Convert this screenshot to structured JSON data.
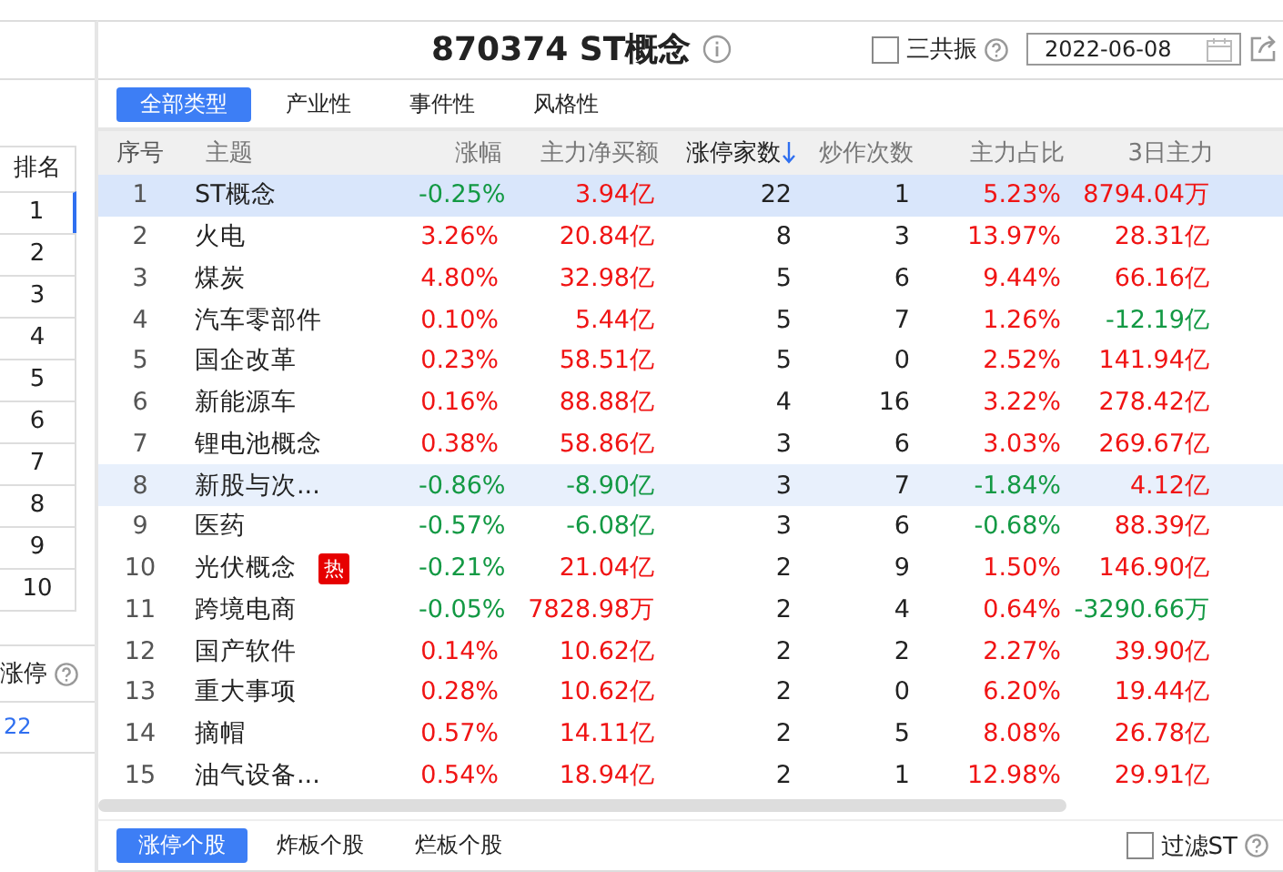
{
  "left_panel": {
    "rank_header": "排名",
    "ranks": [
      {
        "label": "1",
        "selected": true
      },
      {
        "label": "2",
        "selected": false
      },
      {
        "label": "3",
        "selected": false
      },
      {
        "label": "4",
        "selected": false
      },
      {
        "label": "5",
        "selected": false
      },
      {
        "label": "6",
        "selected": false
      },
      {
        "label": "7",
        "selected": false
      },
      {
        "label": "8",
        "selected": false
      },
      {
        "label": "9",
        "selected": false
      },
      {
        "label": "10",
        "selected": false
      }
    ],
    "limit_up_label": "涨停",
    "limit_up_value": "22"
  },
  "header": {
    "title": "870374 ST概念",
    "resonance": {
      "label": "三共振",
      "checked": false
    },
    "date": "2022-06-08"
  },
  "tabs": [
    {
      "label": "全部类型",
      "selected": true
    },
    {
      "label": "产业性",
      "selected": false
    },
    {
      "label": "事件性",
      "selected": false
    },
    {
      "label": "风格性",
      "selected": false
    }
  ],
  "table": {
    "columns": [
      {
        "label": "序号",
        "sorted": false
      },
      {
        "label": "主题",
        "sorted": false
      },
      {
        "label": "涨幅",
        "sorted": false
      },
      {
        "label": "主力净买额",
        "sorted": false
      },
      {
        "label": "涨停家数",
        "sorted": true
      },
      {
        "label": "炒作次数",
        "sorted": false
      },
      {
        "label": "主力占比",
        "sorted": false
      },
      {
        "label": "3日主力",
        "sorted": false
      }
    ],
    "rows": [
      {
        "no": "1",
        "name": "ST概念",
        "hot": false,
        "selected": true,
        "highlighted": false,
        "change": {
          "text": "-0.25%",
          "rising": false
        },
        "net": {
          "text": "3.94亿",
          "rising": true
        },
        "limit_ups": "22",
        "times": "1",
        "ratio": {
          "text": "5.23%",
          "rising": true
        },
        "day3": {
          "text": "8794.04万",
          "rising": true
        }
      },
      {
        "no": "2",
        "name": "火电",
        "hot": false,
        "selected": false,
        "highlighted": false,
        "change": {
          "text": "3.26%",
          "rising": true
        },
        "net": {
          "text": "20.84亿",
          "rising": true
        },
        "limit_ups": "8",
        "times": "3",
        "ratio": {
          "text": "13.97%",
          "rising": true
        },
        "day3": {
          "text": "28.31亿",
          "rising": true
        }
      },
      {
        "no": "3",
        "name": "煤炭",
        "hot": false,
        "selected": false,
        "highlighted": false,
        "change": {
          "text": "4.80%",
          "rising": true
        },
        "net": {
          "text": "32.98亿",
          "rising": true
        },
        "limit_ups": "5",
        "times": "6",
        "ratio": {
          "text": "9.44%",
          "rising": true
        },
        "day3": {
          "text": "66.16亿",
          "rising": true
        }
      },
      {
        "no": "4",
        "name": "汽车零部件",
        "hot": false,
        "selected": false,
        "highlighted": false,
        "change": {
          "text": "0.10%",
          "rising": true
        },
        "net": {
          "text": "5.44亿",
          "rising": true
        },
        "limit_ups": "5",
        "times": "7",
        "ratio": {
          "text": "1.26%",
          "rising": true
        },
        "day3": {
          "text": "-12.19亿",
          "rising": false
        }
      },
      {
        "no": "5",
        "name": "国企改革",
        "hot": false,
        "selected": false,
        "highlighted": false,
        "change": {
          "text": "0.23%",
          "rising": true
        },
        "net": {
          "text": "58.51亿",
          "rising": true
        },
        "limit_ups": "5",
        "times": "0",
        "ratio": {
          "text": "2.52%",
          "rising": true
        },
        "day3": {
          "text": "141.94亿",
          "rising": true
        }
      },
      {
        "no": "6",
        "name": "新能源车",
        "hot": false,
        "selected": false,
        "highlighted": false,
        "change": {
          "text": "0.16%",
          "rising": true
        },
        "net": {
          "text": "88.88亿",
          "rising": true
        },
        "limit_ups": "4",
        "times": "16",
        "ratio": {
          "text": "3.22%",
          "rising": true
        },
        "day3": {
          "text": "278.42亿",
          "rising": true
        }
      },
      {
        "no": "7",
        "name": "锂电池概念",
        "hot": false,
        "selected": false,
        "highlighted": false,
        "change": {
          "text": "0.38%",
          "rising": true
        },
        "net": {
          "text": "58.86亿",
          "rising": true
        },
        "limit_ups": "3",
        "times": "6",
        "ratio": {
          "text": "3.03%",
          "rising": true
        },
        "day3": {
          "text": "269.67亿",
          "rising": true
        }
      },
      {
        "no": "8",
        "name": "新股与次...",
        "hot": false,
        "selected": false,
        "highlighted": true,
        "change": {
          "text": "-0.86%",
          "rising": false
        },
        "net": {
          "text": "-8.90亿",
          "rising": false
        },
        "limit_ups": "3",
        "times": "7",
        "ratio": {
          "text": "-1.84%",
          "rising": false
        },
        "day3": {
          "text": "4.12亿",
          "rising": true
        }
      },
      {
        "no": "9",
        "name": "医药",
        "hot": false,
        "selected": false,
        "highlighted": false,
        "change": {
          "text": "-0.57%",
          "rising": false
        },
        "net": {
          "text": "-6.08亿",
          "rising": false
        },
        "limit_ups": "3",
        "times": "6",
        "ratio": {
          "text": "-0.68%",
          "rising": false
        },
        "day3": {
          "text": "88.39亿",
          "rising": true
        }
      },
      {
        "no": "10",
        "name": "光伏概念",
        "hot": true,
        "hot_label": "热",
        "selected": false,
        "highlighted": false,
        "change": {
          "text": "-0.21%",
          "rising": false
        },
        "net": {
          "text": "21.04亿",
          "rising": true
        },
        "limit_ups": "2",
        "times": "9",
        "ratio": {
          "text": "1.50%",
          "rising": true
        },
        "day3": {
          "text": "146.90亿",
          "rising": true
        }
      },
      {
        "no": "11",
        "name": "跨境电商",
        "hot": false,
        "selected": false,
        "highlighted": false,
        "change": {
          "text": "-0.05%",
          "rising": false
        },
        "net": {
          "text": "7828.98万",
          "rising": true
        },
        "limit_ups": "2",
        "times": "4",
        "ratio": {
          "text": "0.64%",
          "rising": true
        },
        "day3": {
          "text": "-3290.66万",
          "rising": false
        }
      },
      {
        "no": "12",
        "name": "国产软件",
        "hot": false,
        "selected": false,
        "highlighted": false,
        "change": {
          "text": "0.14%",
          "rising": true
        },
        "net": {
          "text": "10.62亿",
          "rising": true
        },
        "limit_ups": "2",
        "times": "2",
        "ratio": {
          "text": "2.27%",
          "rising": true
        },
        "day3": {
          "text": "39.90亿",
          "rising": true
        }
      },
      {
        "no": "13",
        "name": "重大事项",
        "hot": false,
        "selected": false,
        "highlighted": false,
        "change": {
          "text": "0.28%",
          "rising": true
        },
        "net": {
          "text": "10.62亿",
          "rising": true
        },
        "limit_ups": "2",
        "times": "0",
        "ratio": {
          "text": "6.20%",
          "rising": true
        },
        "day3": {
          "text": "19.44亿",
          "rising": true
        }
      },
      {
        "no": "14",
        "name": "摘帽",
        "hot": false,
        "selected": false,
        "highlighted": false,
        "change": {
          "text": "0.57%",
          "rising": true
        },
        "net": {
          "text": "14.11亿",
          "rising": true
        },
        "limit_ups": "2",
        "times": "5",
        "ratio": {
          "text": "8.08%",
          "rising": true
        },
        "day3": {
          "text": "26.78亿",
          "rising": true
        }
      },
      {
        "no": "15",
        "name": "油气设备...",
        "hot": false,
        "selected": false,
        "highlighted": false,
        "change": {
          "text": "0.54%",
          "rising": true
        },
        "net": {
          "text": "18.94亿",
          "rising": true
        },
        "limit_ups": "2",
        "times": "1",
        "ratio": {
          "text": "12.98%",
          "rising": true
        },
        "day3": {
          "text": "29.91亿",
          "rising": true
        }
      }
    ]
  },
  "bottom_tabs": [
    {
      "label": "涨停个股",
      "selected": true
    },
    {
      "label": "炸板个股",
      "selected": false
    },
    {
      "label": "烂板个股",
      "selected": false
    }
  ],
  "filter_st": {
    "label": "过滤ST",
    "checked": false
  }
}
